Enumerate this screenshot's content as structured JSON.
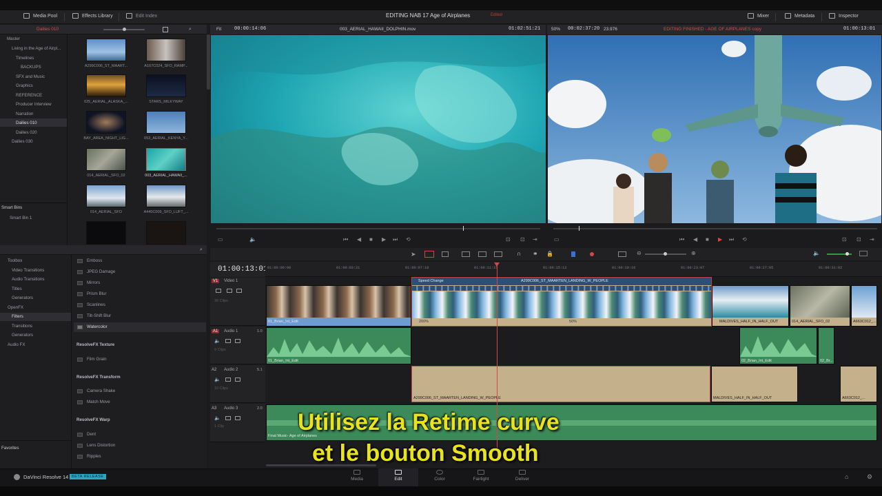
{
  "menubar": {
    "media_pool": "Media Pool",
    "effects_library": "Effects Library",
    "edit_index": "Edit Index",
    "project_title": "EDITING NAB 17 Age of Airplanes",
    "edited_badge": "Edited",
    "mixer": "Mixer",
    "metadata": "Metadata",
    "inspector": "Inspector"
  },
  "media_pool": {
    "bin_title": "Dailies 010",
    "tree": [
      "Master",
      "Living in the Age of Airpl...",
      "Timelines",
      "BACKUPS",
      "SFX and Music",
      "Graphics",
      "REFERENCE",
      "Producer Interview",
      "Narration",
      "Dailies 010",
      "Dailies 020",
      "Dailies 030"
    ],
    "smart_bins": "Smart Bins",
    "smart_bin_1": "Smart Bin 1",
    "clips": [
      "A299C006_ST_MAART...",
      "A167C024_SFO_RAMP...",
      "025_AERIAL_ALASKA_...",
      "STARS_MILKYWAY",
      "BAY_AREA_NIGHT_LIG...",
      "053_AERIAL_KENYA_Y...",
      "014_AERIAL_SFO_02",
      "003_AERIAL_HAWAII_...",
      "014_AERIAL_SFO",
      "A440C009_SFO_LUFT_...",
      "",
      ""
    ]
  },
  "effects": {
    "tree": [
      "Toolbox",
      "Video Transitions",
      "Audio Transitions",
      "Titles",
      "Generators",
      "OpenFX",
      "Filters",
      "Transitions",
      "Generators",
      "Audio FX"
    ],
    "favorites": "Favorites",
    "items_top": [
      "Emboss",
      "JPEG Damage",
      "Mirrors",
      "Prism Blur",
      "Scanlines",
      "Tilt-Shift Blur",
      "Watercolor"
    ],
    "hdr_texture": "ResolveFX Texture",
    "items_texture": [
      "Film Grain"
    ],
    "hdr_transform": "ResolveFX Transform",
    "items_transform": [
      "Camera Shake",
      "Match Move"
    ],
    "hdr_warp": "ResolveFX Warp",
    "items_warp": [
      "Dent",
      "Lens Distortion",
      "Ripples"
    ]
  },
  "source_viewer": {
    "zoom": "Fit",
    "timecode_left": "00:00:14:06",
    "clip_name": "003_AERIAL_HAWAII_DOLPHIN.mov",
    "timecode_right": "01:02:51:21"
  },
  "record_viewer": {
    "zoom": "50%",
    "timecode_left": "00:02:37:20",
    "fps": "23.976",
    "timeline_name": "EDITING FINISHED - AGE OF AIRPLANES copy",
    "timecode_right": "01:00:13:01"
  },
  "timeline": {
    "current_tc": "01:00:13:01",
    "ruler": [
      "01:00:00:00",
      "01:00:03:21",
      "01:00:07:18",
      "01:00:11:15",
      "01:00:15:13",
      "01:00:19:10",
      "01:00:23:07",
      "01:00:27:05",
      "01:00:31:02"
    ],
    "tracks": {
      "v1": {
        "id": "V1",
        "name": "Video 1",
        "clips": "36 Clips"
      },
      "a1": {
        "id": "A1",
        "name": "Audio 1",
        "ch": "1.0",
        "clips": "9 Clips"
      },
      "a2": {
        "id": "A2",
        "name": "Audio 2",
        "ch": "5.1",
        "clips": "10 Clips"
      },
      "a3": {
        "id": "A3",
        "name": "Audio 3",
        "ch": "2.0",
        "clips": "1 Clip"
      }
    },
    "v_clips": {
      "brian": "01_Brian_Int_Edit",
      "speed_change": "Speed Change",
      "maarten_top": "A299C006_ST_MAARTEN_LANDING_W_PEOPLE",
      "pct_200": "200%",
      "pct_50": "50%",
      "maldives": "MALDIVES_HALF_IN_HALF_OUT",
      "sfo02": "014_AERIAL_SFO_02",
      "a663": "A663C012_..."
    },
    "a_clips": {
      "a1_brian": "01_Brian_Int_Edit",
      "a1_brian2": "02_Brian_Int_Edit",
      "a1_brian3": "02_Br...",
      "a2_maarten": "A299C006_ST_MAARTEN_LANDING_W_PEOPLE",
      "a2_maldives": "MALDIVES_HALF_IN_HALF_OUT",
      "a2_a663": "A663C012_...",
      "a3_music": "Final Music- Age of Airplanes"
    }
  },
  "subtitle": {
    "line1": "Utilisez la Retime curve",
    "line2": "et le bouton Smooth"
  },
  "pages": [
    "Media",
    "Edit",
    "Color",
    "Fairlight",
    "Deliver"
  ],
  "app": {
    "name": "DaVinci Resolve 14",
    "badge": "BETA RELEASE"
  }
}
